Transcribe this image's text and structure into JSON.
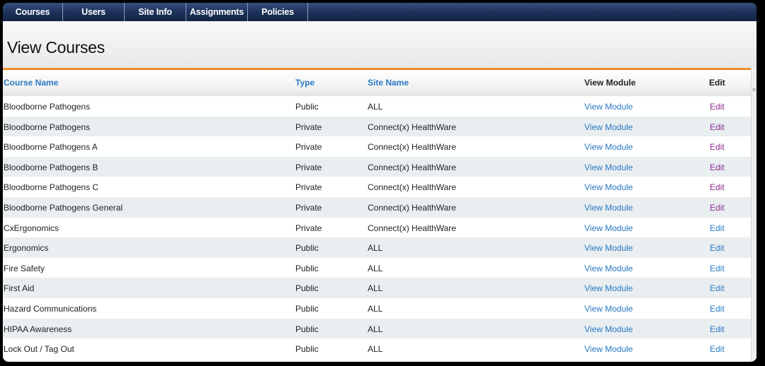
{
  "nav": [
    "Courses",
    "Users",
    "Site Info",
    "Assignments",
    "Policies"
  ],
  "page_title": "View Courses",
  "columns": {
    "name": "Course Name",
    "type": "Type",
    "site": "Site Name",
    "view": "View Module",
    "edit": "Edit"
  },
  "colors": {
    "link_blue": "#2a78c4",
    "visited_purple": "#8b2c8e",
    "accent_orange": "#e8891e",
    "nav_dark": "#1b2f57"
  },
  "rows": [
    {
      "name": "Bloodborne Pathogens",
      "type": "Public",
      "site": "ALL",
      "view": "View Module",
      "edit": "Edit",
      "edit_state": "visited"
    },
    {
      "name": "Bloodborne Pathogens",
      "type": "Private",
      "site": "Connect(x) HealthWare",
      "view": "View Module",
      "edit": "Edit",
      "edit_state": "visited"
    },
    {
      "name": "Bloodborne Pathogens A",
      "type": "Private",
      "site": "Connect(x) HealthWare",
      "view": "View Module",
      "edit": "Edit",
      "edit_state": "visited"
    },
    {
      "name": "Bloodborne Pathogens B",
      "type": "Private",
      "site": "Connect(x) HealthWare",
      "view": "View Module",
      "edit": "Edit",
      "edit_state": "visited"
    },
    {
      "name": "Bloodborne Pathogens C",
      "type": "Private",
      "site": "Connect(x) HealthWare",
      "view": "View Module",
      "edit": "Edit",
      "edit_state": "visited"
    },
    {
      "name": "Bloodborne Pathogens General",
      "type": "Private",
      "site": "Connect(x) HealthWare",
      "view": "View Module",
      "edit": "Edit",
      "edit_state": "visited"
    },
    {
      "name": "CxErgonomics",
      "type": "Private",
      "site": "Connect(x) HealthWare",
      "view": "View Module",
      "edit": "Edit",
      "edit_state": "link"
    },
    {
      "name": "Ergonomics",
      "type": "Public",
      "site": "ALL",
      "view": "View Module",
      "edit": "Edit",
      "edit_state": "link"
    },
    {
      "name": "Fire Safety",
      "type": "Public",
      "site": "ALL",
      "view": "View Module",
      "edit": "Edit",
      "edit_state": "link"
    },
    {
      "name": "First Aid",
      "type": "Public",
      "site": "ALL",
      "view": "View Module",
      "edit": "Edit",
      "edit_state": "link"
    },
    {
      "name": "Hazard Communications",
      "type": "Public",
      "site": "ALL",
      "view": "View Module",
      "edit": "Edit",
      "edit_state": "link"
    },
    {
      "name": "HIPAA Awareness",
      "type": "Public",
      "site": "ALL",
      "view": "View Module",
      "edit": "Edit",
      "edit_state": "link"
    },
    {
      "name": "Lock Out / Tag Out",
      "type": "Public",
      "site": "ALL",
      "view": "View Module",
      "edit": "Edit",
      "edit_state": "link"
    }
  ]
}
